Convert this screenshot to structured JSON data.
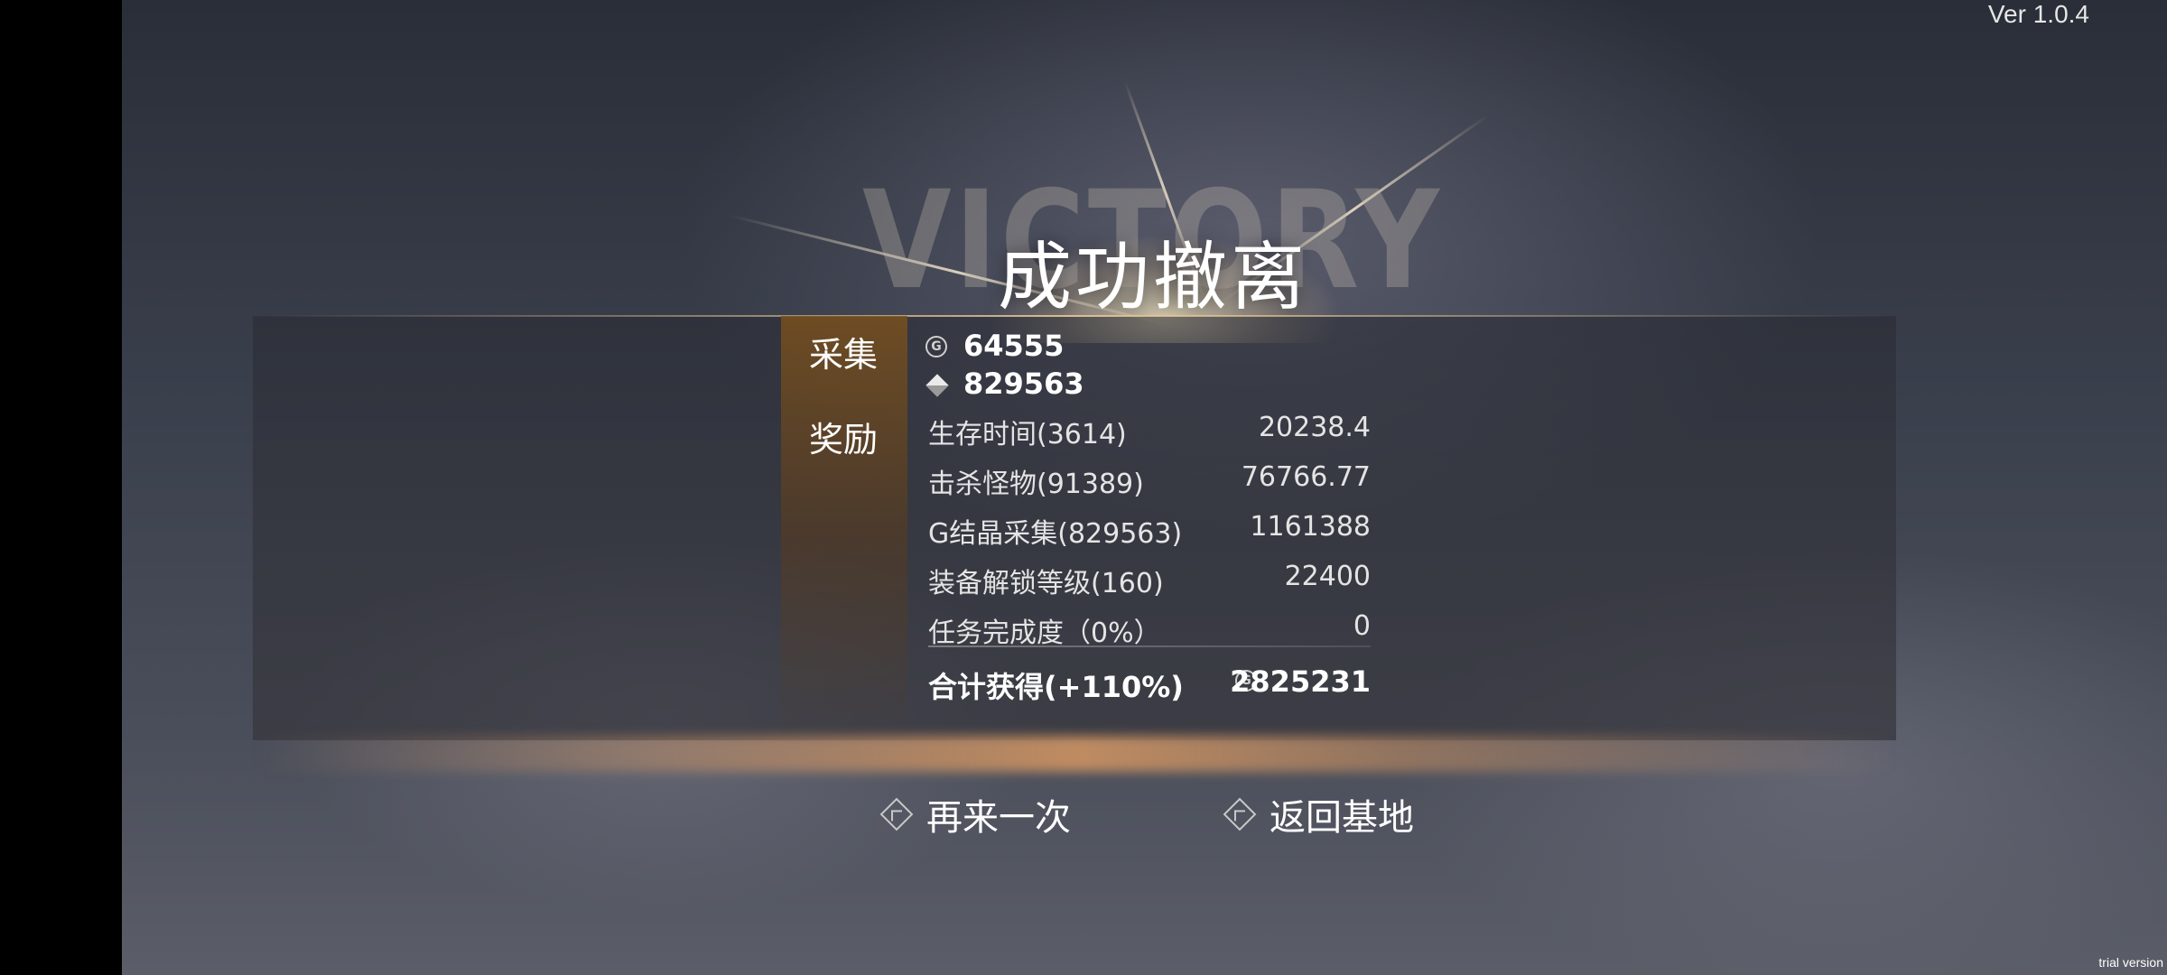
{
  "version": "Ver 1.0.4",
  "trial_mark": "trial version",
  "victory_watermark": "VICTORY",
  "title": "成功撤离",
  "collect": {
    "label": "采集",
    "g_crystal_value": "64555",
    "gem_value": "829563"
  },
  "reward": {
    "label": "奖励",
    "rows": [
      {
        "label": "生存时间(3614)",
        "value": "20238.4"
      },
      {
        "label": "击杀怪物(91389)",
        "value": "76766.77"
      },
      {
        "label": "G结晶采集(829563)",
        "value": "1161388"
      },
      {
        "label": "装备解锁等级(160)",
        "value": "22400"
      },
      {
        "label": "任务完成度（0%）",
        "value": "0"
      }
    ],
    "total_label": "合计获得(+110%)",
    "total_value": "2825231"
  },
  "actions": {
    "retry_label": "再来一次",
    "return_label": "返回基地"
  },
  "icons": {
    "g_coin": "g-coin-icon",
    "gem": "gem-icon",
    "retry": "retry-icon",
    "return": "return-icon"
  }
}
